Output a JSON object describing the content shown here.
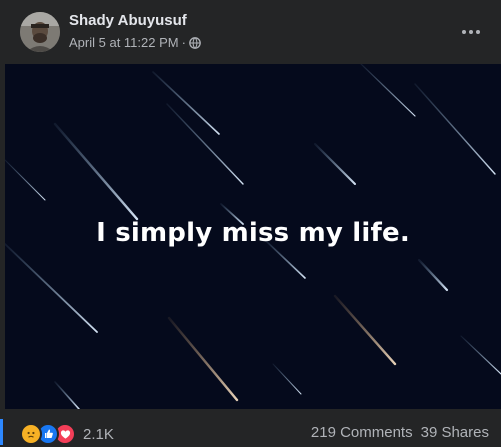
{
  "post": {
    "author": "Shady Abuyusuf",
    "timestamp": "April 5 at 11:22 PM",
    "separator": "·",
    "privacy_icon": "globe-icon",
    "more_icon": "more-options-icon"
  },
  "media": {
    "caption": "I simply miss my life.",
    "background_color": "#050a1c"
  },
  "footer": {
    "reaction_icons": [
      "sad-reaction-icon",
      "like-reaction-icon",
      "love-reaction-icon"
    ],
    "reaction_count": "2.1K",
    "comments": "219 Comments",
    "shares": "39 Shares"
  },
  "colors": {
    "card_bg": "#242526",
    "text_primary": "#e4e6eb",
    "text_secondary": "#b0b3b8",
    "accent": "#2d88ff"
  }
}
